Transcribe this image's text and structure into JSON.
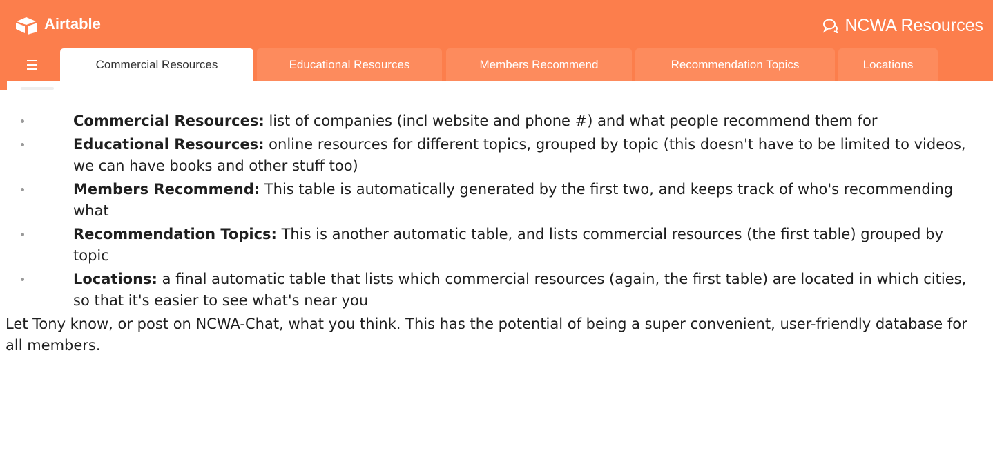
{
  "app": {
    "brand": "Airtable",
    "base_title": "NCWA Resources",
    "accent_color": "#fc7e4c",
    "icons": [
      "airtable-logo-icon",
      "chat-icon",
      "menu-icon"
    ]
  },
  "tabs": [
    {
      "label": "Commercial Resources",
      "active": true
    },
    {
      "label": "Educational Resources",
      "active": false
    },
    {
      "label": "Members Recommend",
      "active": false
    },
    {
      "label": "Recommendation Topics",
      "active": false
    },
    {
      "label": "Locations",
      "active": false
    }
  ],
  "bullets": [
    {
      "term": "Commercial Resources:",
      "text": " list of companies (incl website and phone #) and what people recommend them for"
    },
    {
      "term": "Educational Resources:",
      "text": " online resources for different topics, grouped by topic (this doesn't have to be limited to videos, we can have books and other stuff too)"
    },
    {
      "term": "Members Recommend:",
      "text": " This table is automatically generated by the first two, and keeps track of who's recommending what"
    },
    {
      "term": "Recommendation Topics:",
      "text": " This is another automatic table, and lists commercial resources (the first table) grouped by topic"
    },
    {
      "term": "Locations:",
      "text": " a final automatic table that lists which commercial resources (again, the first table) are located in which cities, so that it's easier to see what's near you"
    }
  ],
  "outro": "Let Tony know, or post on NCWA-Chat, what you think. This has the potential of being a super convenient, user-friendly database for all members."
}
